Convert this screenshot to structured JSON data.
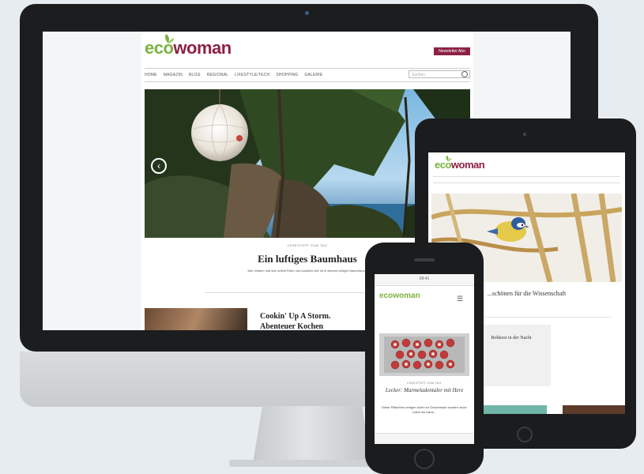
{
  "desktop": {
    "logo_eco": "eco",
    "logo_woman": "woman",
    "newsletter_button": "Newsletter Abo",
    "nav": [
      "HOME",
      "MAGAZIN",
      "BLOG",
      "REGIONAL",
      "LIFESTYLE/TECH",
      "SHOPPING",
      "GALERIE"
    ],
    "search_placeholder": "Suchen",
    "hero_prev_arrow": "‹",
    "kicker": "LESESTOFF ZUM TAG",
    "headline": "Ein luftiges Baumhaus",
    "teaser": "Wer einfach mal sich selbst Ruhe und Ausblick will, ist in diesem luftigen Baumhaus...",
    "second_story": "Cookin' Up A Storm. Abenteuer Kochen"
  },
  "tablet": {
    "logo_eco": "eco",
    "logo_woman": "woman",
    "headline": "...schönen für die Wissenschaft",
    "side_card_title": "Rohkost in der Nacht"
  },
  "phone": {
    "logo": "ecowoman",
    "kicker": "LESESTOFF ZUM TAG",
    "headline": "Lecker: Marmeladentaler mit Herz",
    "teaser": "Diese Plätzchen bringen nicht nur Geschmack sondern auch Liebe ins Haus...",
    "status_time": "09:41",
    "menu_icon": "☰"
  },
  "colors": {
    "brand_green": "#7cb342",
    "brand_magenta": "#8d2145",
    "device_black": "#1c1d1f",
    "background": "#e6ecef"
  }
}
